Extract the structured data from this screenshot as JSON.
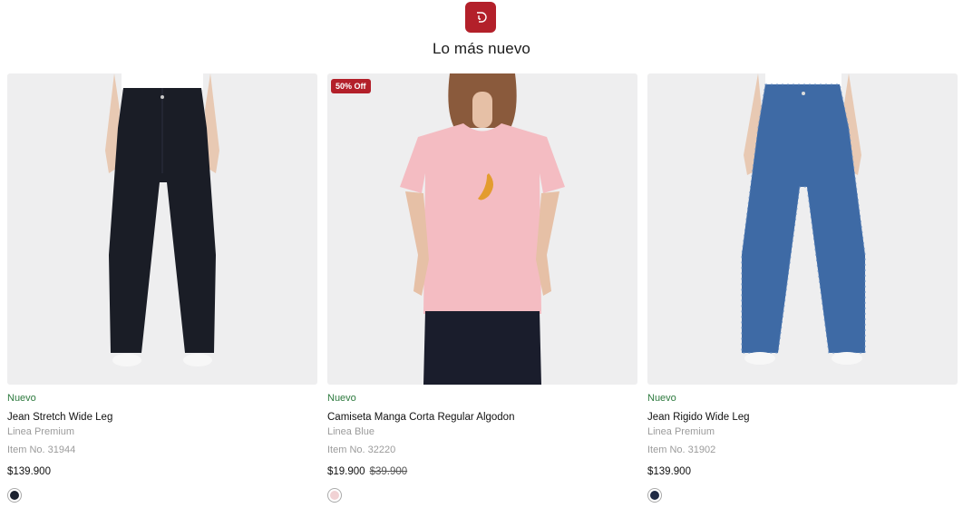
{
  "brand": {
    "icon": "brand-logo-icon",
    "color": "#b3202a"
  },
  "section": {
    "title": "Lo más nuevo"
  },
  "products": [
    {
      "badge": "",
      "tag": "Nuevo",
      "name": "Jean Stretch Wide Leg",
      "line": "Linea Premium",
      "item_no": "Item No. 31944",
      "price": "$139.900",
      "old_price": "",
      "swatch_color": "#1c2230"
    },
    {
      "badge": "50% Off",
      "tag": "Nuevo",
      "name": "Camiseta Manga Corta Regular Algodon",
      "line": "Linea Blue",
      "item_no": "Item No. 32220",
      "price": "$19.900",
      "old_price": "$39.900",
      "swatch_color": "#f1d2d4"
    },
    {
      "badge": "",
      "tag": "Nuevo",
      "name": "Jean Rigido Wide Leg",
      "line": "Linea Premium",
      "item_no": "Item No. 31902",
      "price": "$139.900",
      "old_price": "",
      "swatch_color": "#1f2a44"
    }
  ]
}
